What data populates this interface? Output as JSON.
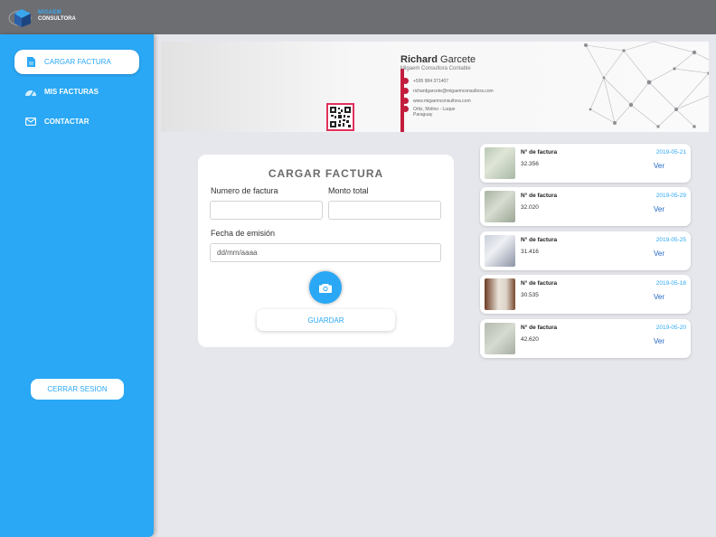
{
  "brand": {
    "logo_line1": "MIGAEM",
    "logo_line2": "CONSULTORA"
  },
  "sidebar": {
    "items": [
      {
        "label": "CARGAR FACTURA",
        "icon": "document-icon"
      },
      {
        "label": "MIS FACTURAS",
        "icon": "gauge-icon"
      },
      {
        "label": "CONTACTAR",
        "icon": "mail-icon"
      }
    ],
    "logout_label": "CERRAR SESION"
  },
  "banner": {
    "first_name": "Richard",
    "last_name": "Garcete",
    "company": "Migaem Consultora Contable",
    "phone": "+595 984 371407",
    "email": "richardgarcete@migaemconsultora.com",
    "web": "www.migaemconsultora.com",
    "address1": "Ortiz, Molino - Luque",
    "address2": "Paraguay"
  },
  "form": {
    "title": "CARGAR FACTURA",
    "invoice_number_label": "Numero de factura",
    "total_label": "Monto total",
    "date_label": "Fecha de emisión",
    "date_placeholder": "dd/mm/aaaa",
    "save_label": "GUARDAR"
  },
  "invoices": [
    {
      "label": "N° de factura",
      "amount": "32.356",
      "date": "2019-05-21",
      "action": "Ver"
    },
    {
      "label": "N° de factura",
      "amount": "32.020",
      "date": "2019-05-29",
      "action": "Ver"
    },
    {
      "label": "N° de factura",
      "amount": "31.416",
      "date": "2019-05-25",
      "action": "Ver"
    },
    {
      "label": "N° de factura",
      "amount": "30.535",
      "date": "2019-05-18",
      "action": "Ver"
    },
    {
      "label": "N° de factura",
      "amount": "42.620",
      "date": "2019-05-20",
      "action": "Ver"
    }
  ],
  "colors": {
    "accent": "#2aa8f5",
    "topbar": "#6d6e72",
    "background": "#e6e7ec",
    "link": "#1f66c4",
    "card_red": "#c21d3d"
  }
}
